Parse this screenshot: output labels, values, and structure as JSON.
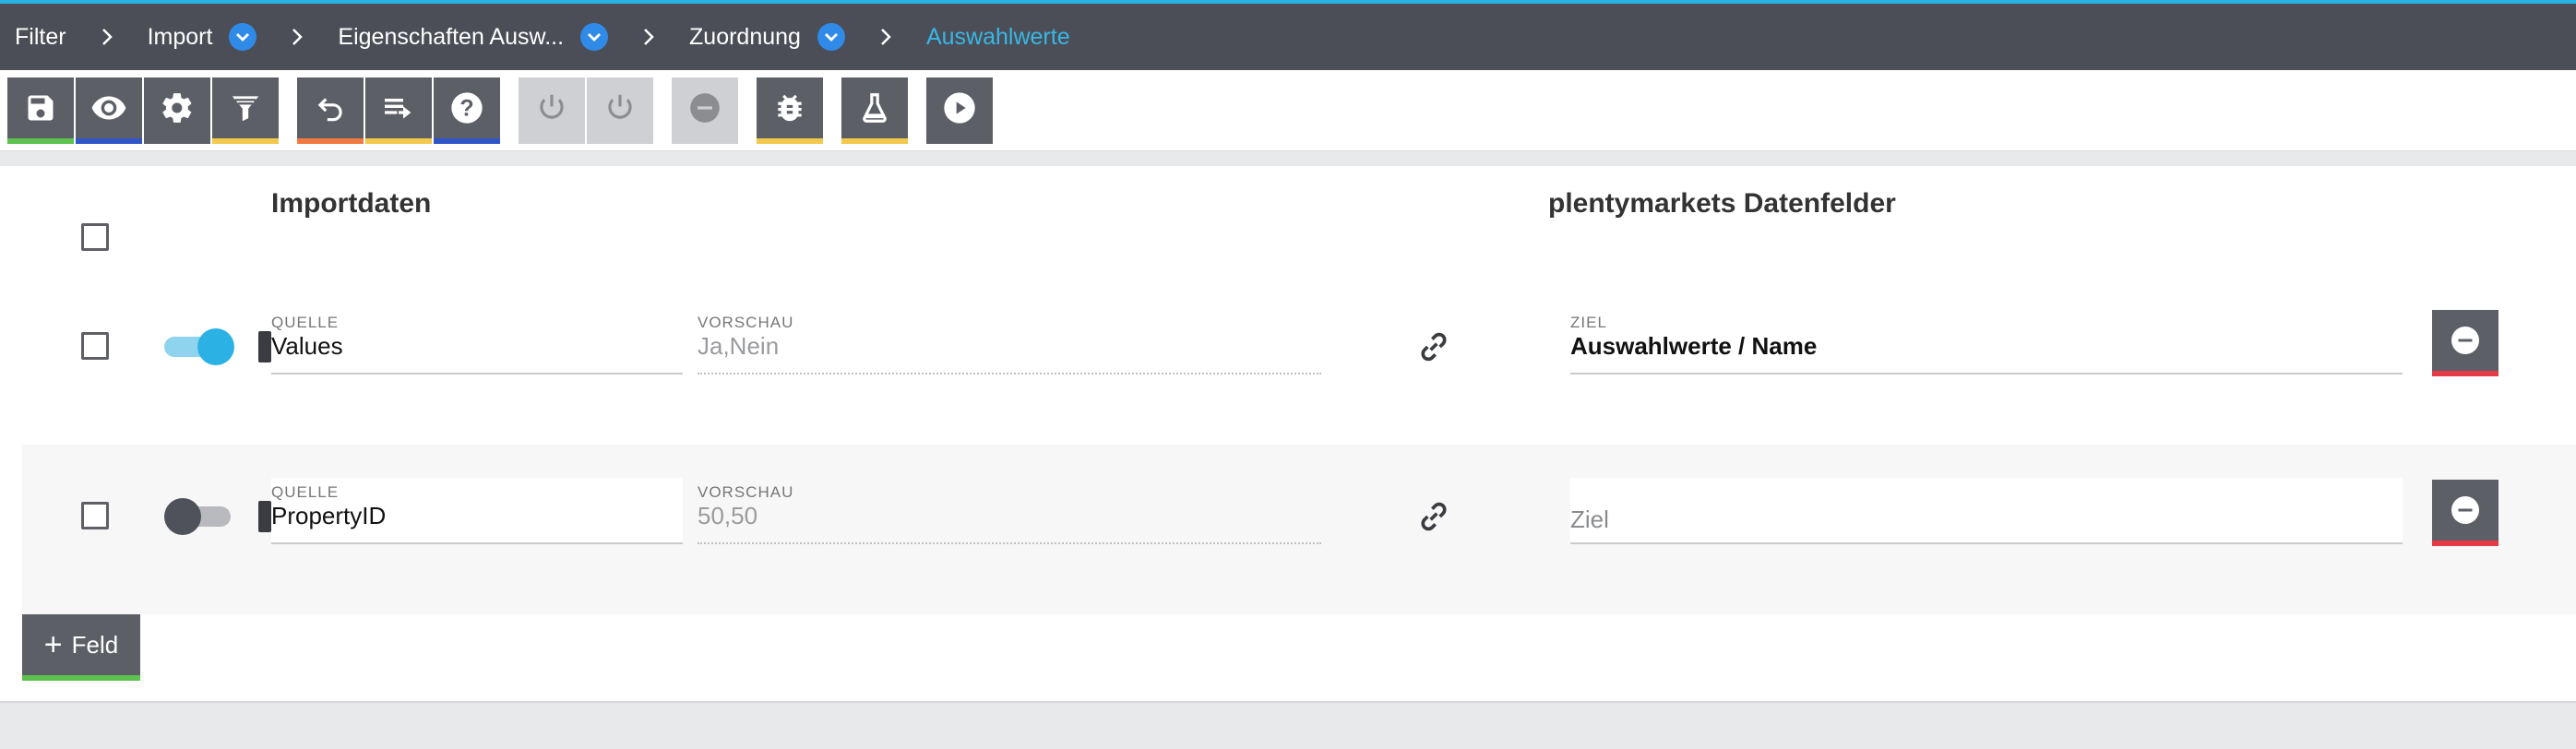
{
  "breadcrumb": {
    "items": [
      {
        "label": "Filter",
        "has_dropdown": false
      },
      {
        "label": "Import",
        "has_dropdown": true
      },
      {
        "label": "Eigenschaften Ausw...",
        "has_dropdown": true
      },
      {
        "label": "Zuordnung",
        "has_dropdown": true
      },
      {
        "label": "Auswahlwerte",
        "has_dropdown": false,
        "active": true
      }
    ],
    "separator_icon": "chevron-right-icon"
  },
  "toolbar": {
    "buttons": [
      {
        "name": "save-button",
        "icon": "floppy-icon",
        "accent": "#5cc24e"
      },
      {
        "name": "preview-button",
        "icon": "eye-icon",
        "accent": "#2f55c9"
      },
      {
        "name": "settings-button",
        "icon": "gear-icon",
        "accent": null
      },
      {
        "name": "filter-button",
        "icon": "funnel-icon",
        "accent": "#f2c94c"
      },
      {
        "name": "undo-button",
        "icon": "undo-icon",
        "accent": "#f07a3f"
      },
      {
        "name": "playlist-button",
        "icon": "playlist-add-icon",
        "accent": "#f2c94c"
      },
      {
        "name": "help-button",
        "icon": "question-icon",
        "accent": "#2f55c9"
      },
      {
        "name": "power-button-1",
        "icon": "power-icon",
        "disabled": true
      },
      {
        "name": "power-button-2",
        "icon": "power-icon",
        "disabled": true
      },
      {
        "name": "minus-button",
        "icon": "minus-circle-icon",
        "disabled": true
      },
      {
        "name": "debug-button",
        "icon": "bug-icon",
        "accent": "#f2c94c"
      },
      {
        "name": "test-button",
        "icon": "flask-icon",
        "accent": "#f2c94c"
      },
      {
        "name": "run-button",
        "icon": "play-icon",
        "accent": null
      }
    ]
  },
  "main": {
    "heading_import": "Importdaten",
    "heading_plenty": "plentymarkets Datenfelder",
    "rows": [
      {
        "enabled": true,
        "source_label": "QUELLE",
        "source_value": "Values",
        "preview_label": "VORSCHAU",
        "preview_value": "Ja,Nein",
        "target_label": "ZIEL",
        "target_value": "Auswahlwerte / Name",
        "target_placeholder": ""
      },
      {
        "enabled": false,
        "source_label": "QUELLE",
        "source_value": "PropertyID",
        "preview_label": "VORSCHAU",
        "preview_value": "50,50",
        "target_label": "",
        "target_value": "",
        "target_placeholder": "Ziel"
      }
    ],
    "add_button": {
      "label": "Feld",
      "icon": "plus-icon"
    }
  },
  "colors": {
    "accent": "#2cb1e4",
    "header_bg": "#4b4e57",
    "button_bg": "#5c5f66",
    "danger": "#e53946",
    "success": "#5cc24e"
  }
}
